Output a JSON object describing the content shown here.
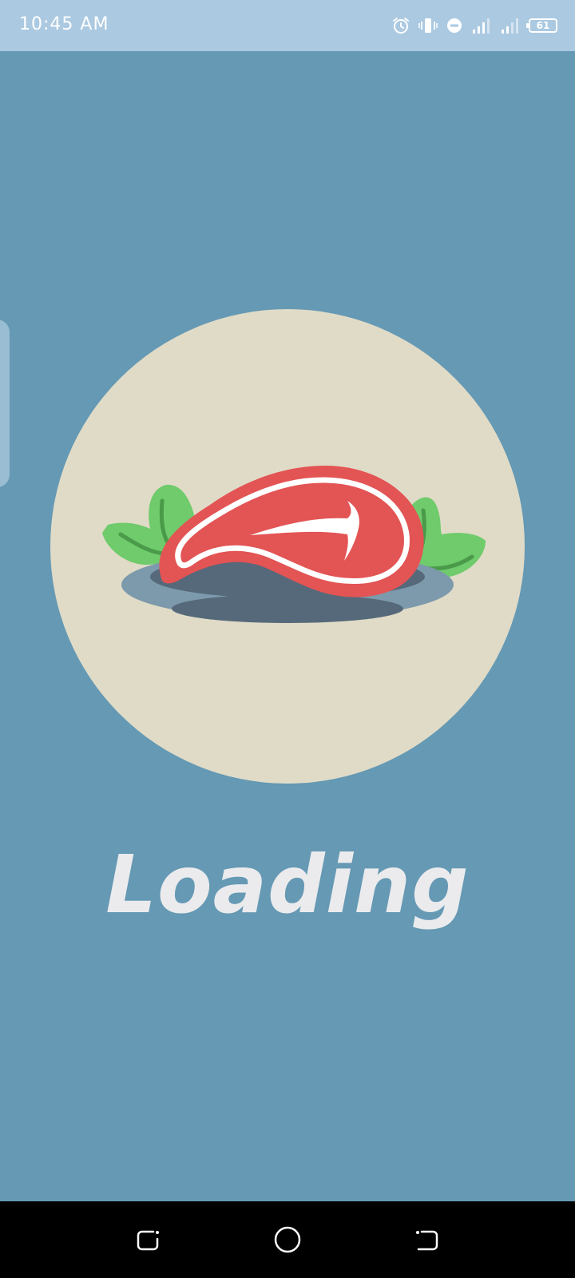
{
  "status_bar": {
    "time": "10:45 AM",
    "battery_level": "61",
    "icons": [
      "alarm-icon",
      "vibrate-icon",
      "do-not-disturb-icon",
      "signal-icon",
      "signal-icon",
      "battery-icon"
    ]
  },
  "splash": {
    "loading_label": "Loading",
    "illustration": "steak-on-plate",
    "colors": {
      "background": "#6599b4",
      "circle": "#e0dbc7",
      "steak": "#e35454",
      "leaves": "#6fcb6b",
      "plate": "#7c9aab",
      "label": "#ebebed"
    }
  },
  "nav_bar": {
    "buttons": [
      "recent-apps-icon",
      "home-icon",
      "back-icon"
    ]
  }
}
